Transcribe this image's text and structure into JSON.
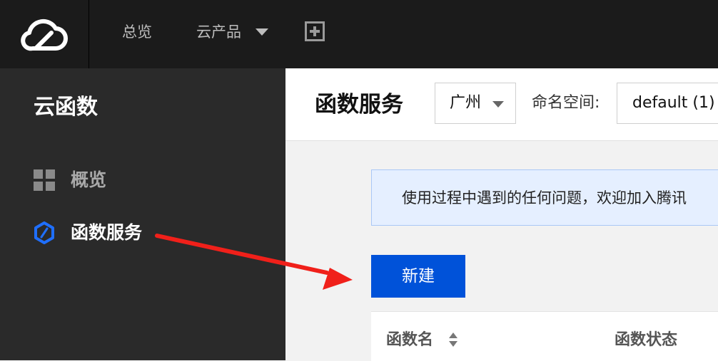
{
  "topbar": {
    "logo_icon": "cloud-logo-icon",
    "nav": {
      "overview": "总览",
      "products": "云产品"
    },
    "products_caret_icon": "caret-down-icon",
    "plus_icon": "plus-square-icon"
  },
  "sidebar": {
    "title": "云函数",
    "items": [
      {
        "label": "概览",
        "icon": "grid-icon"
      },
      {
        "label": "函数服务",
        "icon": "hexagon-slash-icon"
      }
    ]
  },
  "header": {
    "title": "函数服务",
    "region": {
      "value": "广州"
    },
    "namespace": {
      "label": "命名空间:",
      "value": "default (1)"
    }
  },
  "notice": {
    "text": "使用过程中遇到的任何问题，欢迎加入腾讯"
  },
  "actions": {
    "new_label": "新建"
  },
  "table": {
    "columns": [
      "函数名",
      "函数状态"
    ]
  },
  "annotation": {
    "arrow_color": "#f0201a"
  },
  "colors": {
    "accent": "#0052d9",
    "topbar": "#1b1b1b",
    "sidebar": "#2a2a2a"
  }
}
